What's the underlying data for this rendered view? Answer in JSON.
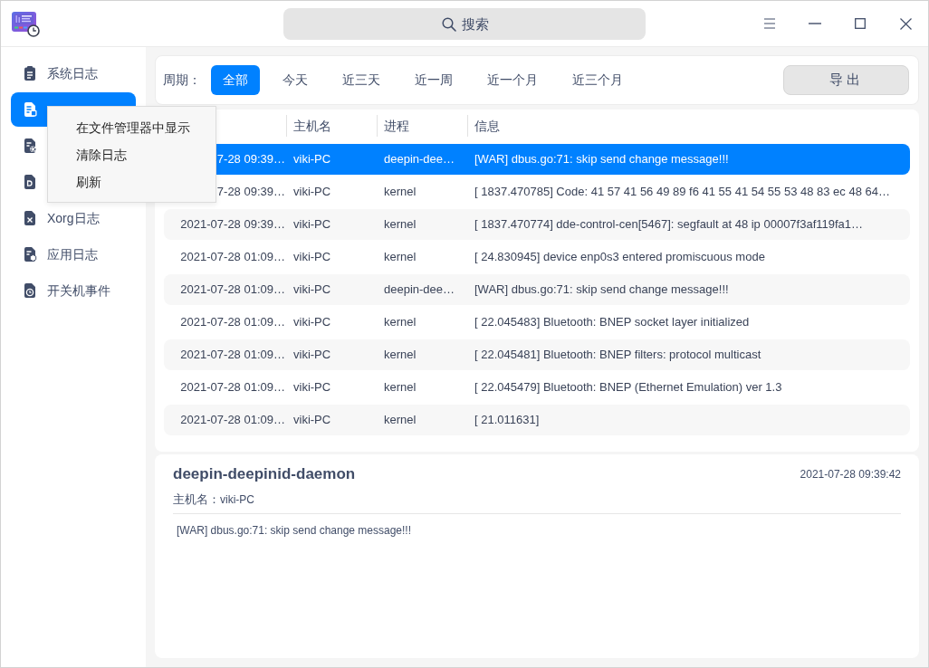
{
  "title_bar": {
    "search": {
      "placeholder": "搜索"
    }
  },
  "sidebar": {
    "items": [
      {
        "label": "系统日志",
        "selected": false
      },
      {
        "selected": true
      },
      {
        "selected": false
      },
      {
        "selected": false
      },
      {
        "label": "Xorg日志",
        "selected": false
      },
      {
        "label": "应用日志",
        "selected": false
      },
      {
        "label": "开关机事件",
        "selected": false
      }
    ]
  },
  "context_menu": {
    "items": [
      "在文件管理器中显示",
      "清除日志",
      "刷新"
    ]
  },
  "filter_bar": {
    "label": "周期：",
    "periods": [
      {
        "label": "全部",
        "selected": true
      },
      {
        "label": "今天",
        "selected": false
      },
      {
        "label": "近三天",
        "selected": false
      },
      {
        "label": "近一周",
        "selected": false
      },
      {
        "label": "近一个月",
        "selected": false
      },
      {
        "label": "近三个月",
        "selected": false
      }
    ],
    "export_button": "导出"
  },
  "table": {
    "columns": [
      "",
      "主机名",
      "进程",
      "信息"
    ],
    "rows": [
      {
        "selected": true,
        "cells": [
          "7-28 09:39…",
          "viki-PC",
          "deepin-dee…",
          "[WAR] dbus.go:71: skip send change message!!!"
        ]
      },
      {
        "selected": false,
        "cells": [
          "7-28 09:39…",
          "viki-PC",
          "kernel",
          "[ 1837.470785] Code: 41 57 41 56 49 89 f6 41 55 41 54 55 53 48 83 ec 48 64…"
        ]
      },
      {
        "selected": false,
        "cells": [
          "2021-07-28 09:39…",
          "viki-PC",
          "kernel",
          "[ 1837.470774] dde-control-cen[5467]: segfault at 48 ip 00007f3af119fa1…"
        ]
      },
      {
        "selected": false,
        "cells": [
          "2021-07-28 01:09…",
          "viki-PC",
          "kernel",
          "[ 24.830945] device enp0s3 entered promiscuous mode"
        ]
      },
      {
        "selected": false,
        "cells": [
          "2021-07-28 01:09…",
          "viki-PC",
          "deepin-dee…",
          "[WAR] dbus.go:71: skip send change message!!!"
        ]
      },
      {
        "selected": false,
        "cells": [
          "2021-07-28 01:09…",
          "viki-PC",
          "kernel",
          "[ 22.045483] Bluetooth: BNEP socket layer initialized"
        ]
      },
      {
        "selected": false,
        "cells": [
          "2021-07-28 01:09…",
          "viki-PC",
          "kernel",
          "[ 22.045481] Bluetooth: BNEP filters: protocol multicast"
        ]
      },
      {
        "selected": false,
        "cells": [
          "2021-07-28 01:09…",
          "viki-PC",
          "kernel",
          "[ 22.045479] Bluetooth: BNEP (Ethernet Emulation) ver 1.3"
        ]
      },
      {
        "selected": false,
        "cells": [
          "2021-07-28 01:09…",
          "viki-PC",
          "kernel",
          "[ 21.011631]"
        ]
      }
    ]
  },
  "detail": {
    "title": "deepin-deepinid-daemon",
    "time": "2021-07-28 09:39:42",
    "host_label": "主机名：",
    "host": "viki-PC",
    "message": "[WAR] dbus.go:71: skip send change message!!!"
  }
}
